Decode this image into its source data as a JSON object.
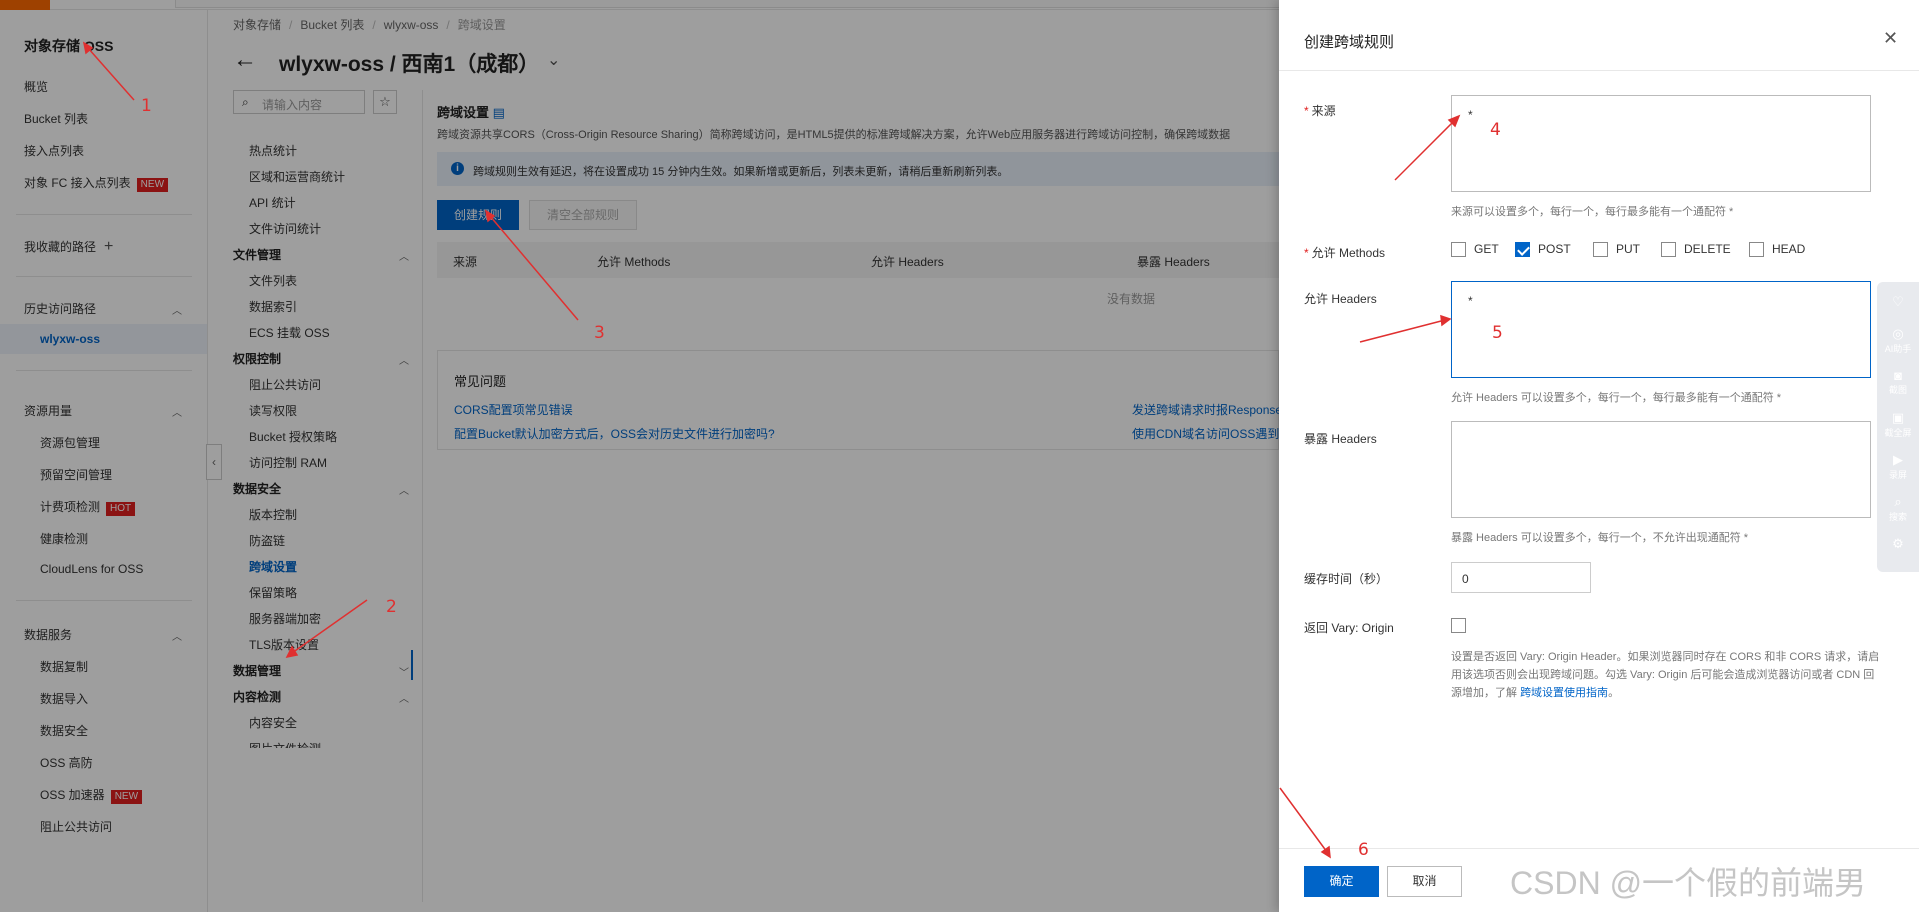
{
  "nav": {
    "title": "对象存储 OSS",
    "overview": "概览",
    "bucket_list": "Bucket 列表",
    "access_points": "接入点列表",
    "fc_access_points": "对象 FC 接入点列表",
    "new_badge": "NEW",
    "hot_badge": "HOT",
    "favorites": "我收藏的路径",
    "plus": "+",
    "history": "历史访问路径",
    "history_item": "wlyxw-oss",
    "resource_usage": "资源用量",
    "resource_pkg": "资源包管理",
    "reserved_space": "预留空间管理",
    "billing_check": "计费项检测",
    "health_check": "健康检测",
    "cloudlens": "CloudLens for OSS",
    "data_services": "数据服务",
    "data_replication": "数据复制",
    "data_import": "数据导入",
    "data_security": "数据安全",
    "oss_ddos": "OSS 高防",
    "oss_accelerator": "OSS 加速器",
    "block_public": "阻止公共访问"
  },
  "breadcrumb": {
    "root": "对象存储",
    "bucket_list": "Bucket 列表",
    "bucket": "wlyxw-oss",
    "current": "跨域设置",
    "sep": "/"
  },
  "page": {
    "back": "←",
    "title": "wlyxw-oss / 西南1（成都）",
    "title_chevron": "⌄"
  },
  "subnav": {
    "search_placeholder": "请输入内容",
    "star": "☆",
    "items": {
      "hot_stats": "热点统计",
      "region_ops": "区域和运营商统计",
      "api_stats": "API 统计",
      "file_access": "文件访问统计",
      "file_mgmt": "文件管理",
      "file_list": "文件列表",
      "data_index": "数据索引",
      "ecs_mount": "ECS 挂载 OSS",
      "perm_ctrl": "权限控制",
      "block_public": "阻止公共访问",
      "rw_perm": "读写权限",
      "bucket_policy": "Bucket 授权策略",
      "ram": "访问控制 RAM",
      "data_security": "数据安全",
      "versioning": "版本控制",
      "hotlink": "防盗链",
      "cors": "跨域设置",
      "retention": "保留策略",
      "sse": "服务器端加密",
      "tls": "TLS版本设置",
      "data_mgmt": "数据管理",
      "content_detect": "内容检测",
      "content_security": "内容安全",
      "partial": "图片文件检测"
    }
  },
  "content": {
    "section_title": "跨域设置",
    "description": "跨域资源共享CORS（Cross-Origin Resource Sharing）简称跨域访问，是HTML5提供的标准跨域解决方案，允许Web应用服务器进行跨域访问控制，确保跨域数据",
    "notice": "跨域规则生效有延迟，将在设置成功 15 分钟内生效。如果新增或更新后，列表未更新，请稍后重新刷新列表。",
    "create_rule": "创建规则",
    "clear_rules": "清空全部规则",
    "columns": [
      "来源",
      "允许 Methods",
      "允许 Headers",
      "暴露 Headers"
    ],
    "empty": "没有数据",
    "faq_title": "常见问题",
    "faq_links": [
      "CORS配置项常见错误",
      "配置Bucket默认加密方式后，OSS会对历史文件进行加密吗?",
      "发送跨域请求时报Response",
      "使用CDN域名访问OSS遇到"
    ],
    "collapse": "‹"
  },
  "drawer": {
    "title": "创建跨域规则",
    "close": "✕",
    "required_mark": "*",
    "source_label": "来源",
    "source_value": "*",
    "source_help": "来源可以设置多个，每行一个，每行最多能有一个通配符 *",
    "methods_label": "允许 Methods",
    "methods": [
      {
        "label": "GET",
        "checked": false
      },
      {
        "label": "POST",
        "checked": true
      },
      {
        "label": "PUT",
        "checked": false
      },
      {
        "label": "DELETE",
        "checked": false
      },
      {
        "label": "HEAD",
        "checked": false
      }
    ],
    "allow_headers_label": "允许 Headers",
    "allow_headers_value": "*",
    "allow_headers_help": "允许 Headers 可以设置多个，每行一个，每行最多能有一个通配符 *",
    "expose_headers_label": "暴露 Headers",
    "expose_headers_value": "",
    "expose_headers_help": "暴露 Headers 可以设置多个，每行一个，不允许出现通配符 *",
    "cache_label": "缓存时间（秒）",
    "cache_value": "0",
    "vary_label": "返回 Vary: Origin",
    "vary_help": "设置是否返回 Vary: Origin Header。如果浏览器同时存在 CORS 和非 CORS 请求，请启用该选项否则会出现跨域问题。勾选 Vary: Origin 后可能会造成浏览器访问或者 CDN 回源增加，了解",
    "vary_link": "跨域设置使用指南",
    "vary_end": "。",
    "ok": "确定",
    "cancel": "取消"
  },
  "floating_toolbar": {
    "items": [
      {
        "icon": "heart-icon",
        "label": ""
      },
      {
        "icon": "ai-icon",
        "label": "AI助手"
      },
      {
        "icon": "camera-icon",
        "label": "截图"
      },
      {
        "icon": "screen-icon",
        "label": "截全屏"
      },
      {
        "icon": "video-icon",
        "label": "录屏"
      },
      {
        "icon": "search-icon",
        "label": "搜索"
      },
      {
        "icon": "settings-icon",
        "label": ""
      }
    ]
  },
  "annotations": [
    "1",
    "2",
    "3",
    "4",
    "5",
    "6"
  ],
  "watermark": "CSDN @一个假的前端男",
  "colors": {
    "primary": "#0064c8",
    "annotation": "#e03030",
    "brand": "#ff6a00"
  }
}
